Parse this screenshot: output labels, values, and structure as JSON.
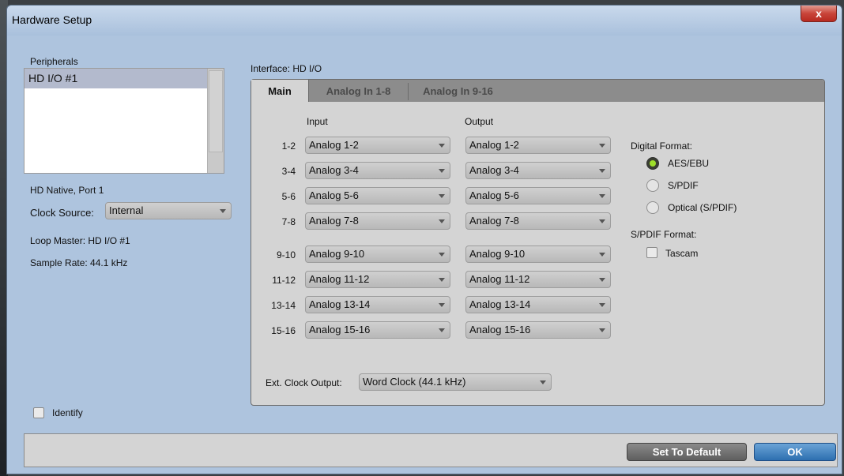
{
  "window": {
    "title": "Hardware Setup",
    "close_label": "x"
  },
  "sidebar": {
    "peripherals_label": "Peripherals",
    "peripherals": [
      "HD I/O #1"
    ],
    "port_text": "HD Native, Port 1",
    "clock_source_label": "Clock Source:",
    "clock_source_value": "Internal",
    "loop_master_text": "Loop Master: HD I/O #1",
    "sample_rate_text": "Sample Rate:  44.1 kHz",
    "identify_label": "Identify"
  },
  "interface": {
    "label": "Interface: HD I/O",
    "tabs": [
      "Main",
      "Analog In 1-8",
      "Analog In 9-16"
    ],
    "active_tab": "Main",
    "input_header": "Input",
    "output_header": "Output",
    "channels": [
      {
        "label": "1-2",
        "input": "Analog 1-2",
        "output": "Analog 1-2"
      },
      {
        "label": "3-4",
        "input": "Analog 3-4",
        "output": "Analog 3-4"
      },
      {
        "label": "5-6",
        "input": "Analog 5-6",
        "output": "Analog 5-6"
      },
      {
        "label": "7-8",
        "input": "Analog 7-8",
        "output": "Analog 7-8"
      },
      {
        "label": "9-10",
        "input": "Analog 9-10",
        "output": "Analog 9-10"
      },
      {
        "label": "11-12",
        "input": "Analog 11-12",
        "output": "Analog 11-12"
      },
      {
        "label": "13-14",
        "input": "Analog 13-14",
        "output": "Analog 13-14"
      },
      {
        "label": "15-16",
        "input": "Analog 15-16",
        "output": "Analog 15-16"
      }
    ],
    "digital_format_label": "Digital Format:",
    "digital_formats": [
      "AES/EBU",
      "S/PDIF",
      "Optical (S/PDIF)"
    ],
    "digital_format_selected": "AES/EBU",
    "spdif_format_label": "S/PDIF Format:",
    "tascam_label": "Tascam",
    "ext_clock_label": "Ext. Clock Output:",
    "ext_clock_value": "Word Clock (44.1 kHz)"
  },
  "footer": {
    "default_button": "Set To Default",
    "ok_button": "OK"
  },
  "colors": {
    "accent_ok": "#2d6fb0",
    "radio_on": "#9fe02a",
    "selection": "#b3bacd"
  }
}
